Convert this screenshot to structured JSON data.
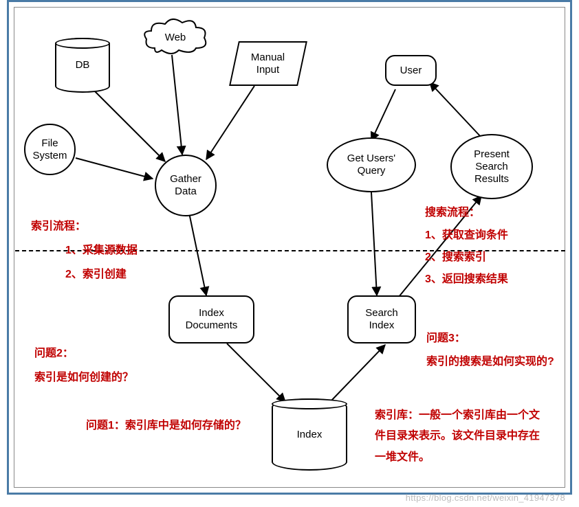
{
  "nodes": {
    "db": "DB",
    "web": "Web",
    "manual_input": "Manual\nInput",
    "file_system": "File\nSystem",
    "gather_data": "Gather\nData",
    "user": "User",
    "get_users_query": "Get Users'\nQuery",
    "present_search_results": "Present\nSearch\nResults",
    "index_documents": "Index\nDocuments",
    "search_index": "Search\nIndex",
    "index": "Index"
  },
  "annotations": {
    "index_flow_title": "索引流程：",
    "index_flow_1": "1、采集源数据",
    "index_flow_2": "2、索引创建",
    "search_flow_title": "搜索流程：",
    "search_flow_1": "1、获取查询条件",
    "search_flow_2": "2、搜索索引",
    "search_flow_3": "3、返回搜索结果",
    "question2_title": "问题2：",
    "question2_text": "索引是如何创建的？",
    "question1": "问题1：索引库中是如何存储的？",
    "question3_title": "问题3：",
    "question3_text": "索引的搜索是如何实现的?",
    "index_lib": "索引库：一般一个索引库由一个文件目录来表示。该文件目录中存在一堆文件。"
  },
  "watermark": "https://blog.csdn.net/weixin_41947378"
}
